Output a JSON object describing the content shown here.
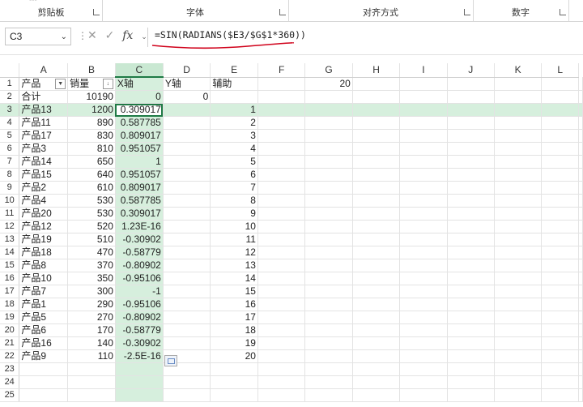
{
  "ribbon": {
    "groups": [
      {
        "label": "剪贴板"
      },
      {
        "label": "字体"
      },
      {
        "label": "对齐方式"
      },
      {
        "label": "数字"
      }
    ]
  },
  "name_box": {
    "value": "C3"
  },
  "formula_bar": {
    "fx_label": "fx",
    "formula": "=SIN(RADIANS($E3/$G$1*360))"
  },
  "columns": [
    "A",
    "B",
    "C",
    "D",
    "E",
    "F",
    "G",
    "H",
    "I",
    "J",
    "K",
    "L"
  ],
  "rows": [
    {
      "n": "1",
      "A": "产品",
      "B": "销量",
      "C": "X轴",
      "D": "Y轴",
      "E": "辅助",
      "G": "20"
    },
    {
      "n": "2",
      "A": "合计",
      "B": "10190",
      "C": "0",
      "D": "0"
    },
    {
      "n": "3",
      "A": "产品13",
      "B": "1200",
      "C": "0.309017",
      "E": "1"
    },
    {
      "n": "4",
      "A": "产品11",
      "B": "890",
      "C": "0.587785",
      "E": "2"
    },
    {
      "n": "5",
      "A": "产品17",
      "B": "830",
      "C": "0.809017",
      "E": "3"
    },
    {
      "n": "6",
      "A": "产品3",
      "B": "810",
      "C": "0.951057",
      "E": "4"
    },
    {
      "n": "7",
      "A": "产品14",
      "B": "650",
      "C": "1",
      "E": "5"
    },
    {
      "n": "8",
      "A": "产品15",
      "B": "640",
      "C": "0.951057",
      "E": "6"
    },
    {
      "n": "9",
      "A": "产品2",
      "B": "610",
      "C": "0.809017",
      "E": "7"
    },
    {
      "n": "10",
      "A": "产品4",
      "B": "530",
      "C": "0.587785",
      "E": "8"
    },
    {
      "n": "11",
      "A": "产品20",
      "B": "530",
      "C": "0.309017",
      "E": "9"
    },
    {
      "n": "12",
      "A": "产品12",
      "B": "520",
      "C": "1.23E-16",
      "E": "10"
    },
    {
      "n": "13",
      "A": "产品19",
      "B": "510",
      "C": "-0.30902",
      "E": "11"
    },
    {
      "n": "14",
      "A": "产品18",
      "B": "470",
      "C": "-0.58779",
      "E": "12"
    },
    {
      "n": "15",
      "A": "产品8",
      "B": "370",
      "C": "-0.80902",
      "E": "13"
    },
    {
      "n": "16",
      "A": "产品10",
      "B": "350",
      "C": "-0.95106",
      "E": "14"
    },
    {
      "n": "17",
      "A": "产品7",
      "B": "300",
      "C": "-1",
      "E": "15"
    },
    {
      "n": "18",
      "A": "产品1",
      "B": "290",
      "C": "-0.95106",
      "E": "16"
    },
    {
      "n": "19",
      "A": "产品5",
      "B": "270",
      "C": "-0.80902",
      "E": "17"
    },
    {
      "n": "20",
      "A": "产品6",
      "B": "170",
      "C": "-0.58779",
      "E": "18"
    },
    {
      "n": "21",
      "A": "产品16",
      "B": "140",
      "C": "-0.30902",
      "E": "19"
    },
    {
      "n": "22",
      "A": "产品9",
      "B": "110",
      "C": "-2.5E-16",
      "E": "20"
    },
    {
      "n": "23"
    },
    {
      "n": "24"
    },
    {
      "n": "25"
    }
  ],
  "colors": {
    "selection": "#1f7a45",
    "column_highlight": "#d6efdd",
    "annotation": "#d0021b"
  }
}
